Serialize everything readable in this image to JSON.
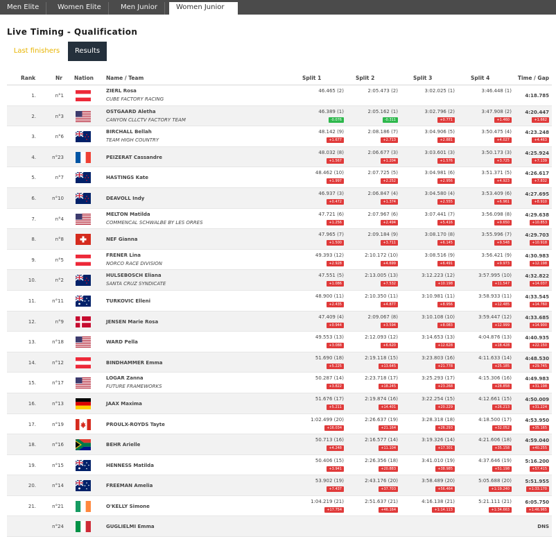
{
  "tabs": [
    "Men Elite",
    "Women Elite",
    "Men Junior",
    "Women Junior"
  ],
  "title": "Live Timing - Qualification",
  "subtabs": {
    "last_finishers": "Last finishers",
    "results": "Results"
  },
  "columns": {
    "rank": "Rank",
    "nr": "Nr",
    "nation": "Nation",
    "name": "Name / Team",
    "split1": "Split 1",
    "split2": "Split 2",
    "split3": "Split 3",
    "split4": "Split 4",
    "time": "Time / Gap"
  },
  "colors": {
    "gap_red": "#e03a3a",
    "gap_green": "#2db84c",
    "accent_yellow": "#e8b400",
    "tab_bar": "#4b4b4b",
    "active_button": "#24303c"
  },
  "rows": [
    {
      "rank": "1.",
      "nr": "n°1",
      "flag": "at",
      "name": "ZIERL Rosa",
      "team": "CUBE FACTORY RACING",
      "s1": "46.465 (2)",
      "s1g": "",
      "s2": "2:05.473 (2)",
      "s2g": "",
      "s3": "3:02.025 (1)",
      "s3g": "",
      "s4": "3:46.448 (1)",
      "s4g": "",
      "time": "4:18.785",
      "gap": ""
    },
    {
      "rank": "2.",
      "nr": "n°3",
      "flag": "us",
      "name": "OSTGAARD Aletha",
      "team": "CANYON CLLCTV FACTORY TEAM",
      "s1": "46.389 (1)",
      "s1g": "-0.076",
      "s1c": "g",
      "s2": "2:05.162 (1)",
      "s2g": "-0.311",
      "s2c": "g",
      "s3": "3:02.796 (2)",
      "s3g": "+0.771",
      "s4": "3:47.908 (2)",
      "s4g": "+1.460",
      "time": "4:20.447",
      "gap": "+1.662"
    },
    {
      "rank": "3.",
      "nr": "n°6",
      "flag": "nz",
      "name": "BIRCHALL Bellah",
      "team": "TEAM HIGH COUNTRY",
      "s1": "48.142 (9)",
      "s1g": "+1.677",
      "s2": "2:08.186 (7)",
      "s2g": "+2.713",
      "s3": "3:04.906 (5)",
      "s3g": "+2.881",
      "s4": "3:50.475 (4)",
      "s4g": "+4.027",
      "time": "4:23.248",
      "gap": "+4.463"
    },
    {
      "rank": "4.",
      "nr": "n°23",
      "flag": "fr",
      "name": "PEIZERAT Cassandre",
      "team": "",
      "s1": "48.032 (8)",
      "s1g": "+1.567",
      "s2": "2:06.677 (3)",
      "s2g": "+1.204",
      "s3": "3:03.601 (3)",
      "s3g": "+1.576",
      "s4": "3:50.173 (3)",
      "s4g": "+3.725",
      "time": "4:25.924",
      "gap": "+7.139"
    },
    {
      "rank": "5.",
      "nr": "n°7",
      "flag": "nz",
      "name": "HASTINGS Kate",
      "team": "",
      "s1": "48.462 (10)",
      "s1g": "+1.997",
      "s2": "2:07.725 (5)",
      "s2g": "+2.252",
      "s3": "3:04.981 (6)",
      "s3g": "+2.956",
      "s4": "3:51.371 (5)",
      "s4g": "+4.923",
      "time": "4:26.617",
      "gap": "+7.832"
    },
    {
      "rank": "6.",
      "nr": "n°10",
      "flag": "nz",
      "name": "DEAVOLL Indy",
      "team": "",
      "s1": "46.937 (3)",
      "s1g": "+0.472",
      "s2": "2:06.847 (4)",
      "s2g": "+1.374",
      "s3": "3:04.580 (4)",
      "s3g": "+2.555",
      "s4": "3:53.409 (6)",
      "s4g": "+6.961",
      "time": "4:27.695",
      "gap": "+8.910"
    },
    {
      "rank": "7.",
      "nr": "n°4",
      "flag": "us",
      "name": "MELTON Matilda",
      "team": "COMMENCAL SCHWALBE BY LES ORRES",
      "s1": "47.721 (6)",
      "s1g": "+1.256",
      "s2": "2:07.967 (6)",
      "s2g": "+2.494",
      "s3": "3:07.441 (7)",
      "s3g": "+5.416",
      "s4": "3:56.098 (8)",
      "s4g": "+9.650",
      "time": "4:29.638",
      "gap": "+10.853"
    },
    {
      "rank": "8.",
      "nr": "n°8",
      "flag": "ch",
      "name": "NEF Gianna",
      "team": "",
      "s1": "47.965 (7)",
      "s1g": "+1.500",
      "s2": "2:09.184 (9)",
      "s2g": "+3.711",
      "s3": "3:08.170 (8)",
      "s3g": "+6.145",
      "s4": "3:55.996 (7)",
      "s4g": "+9.548",
      "time": "4:29.703",
      "gap": "+10.918"
    },
    {
      "rank": "9.",
      "nr": "n°5",
      "flag": "at",
      "name": "FRENER Lina",
      "team": "NORCO RACE DIVISION",
      "s1": "49.393 (12)",
      "s1g": "+2.928",
      "s2": "2:10.172 (10)",
      "s2g": "+4.699",
      "s3": "3:08.516 (9)",
      "s3g": "+6.491",
      "s4": "3:56.421 (9)",
      "s4g": "+9.973",
      "time": "4:30.983",
      "gap": "+12.198"
    },
    {
      "rank": "10.",
      "nr": "n°2",
      "flag": "nz",
      "name": "HULSEBOSCH Eliana",
      "team": "SANTA CRUZ SYNDICATE",
      "s1": "47.551 (5)",
      "s1g": "+1.086",
      "s2": "2:13.005 (13)",
      "s2g": "+7.532",
      "s3": "3:12.223 (12)",
      "s3g": "+10.198",
      "s4": "3:57.995 (10)",
      "s4g": "+11.547",
      "time": "4:32.822",
      "gap": "+14.037"
    },
    {
      "rank": "11.",
      "nr": "n°11",
      "flag": "au",
      "name": "TURKOVIC Elleni",
      "team": "",
      "s1": "48.900 (11)",
      "s1g": "+2.435",
      "s2": "2:10.350 (11)",
      "s2g": "+4.877",
      "s3": "3:10.981 (11)",
      "s3g": "+8.956",
      "s4": "3:58.933 (11)",
      "s4g": "+12.485",
      "time": "4:33.545",
      "gap": "+14.760"
    },
    {
      "rank": "12.",
      "nr": "n°9",
      "flag": "dk",
      "name": "JENSEN Marie Rosa",
      "team": "",
      "s1": "47.409 (4)",
      "s1g": "+0.944",
      "s2": "2:09.067 (8)",
      "s2g": "+3.594",
      "s3": "3:10.108 (10)",
      "s3g": "+8.083",
      "s4": "3:59.447 (12)",
      "s4g": "+12.999",
      "time": "4:33.685",
      "gap": "+14.900"
    },
    {
      "rank": "13.",
      "nr": "n°18",
      "flag": "us",
      "name": "WARD Pella",
      "team": "",
      "s1": "49.553 (13)",
      "s1g": "+3.088",
      "s2": "2:12.093 (12)",
      "s2g": "+6.620",
      "s3": "3:14.653 (13)",
      "s3g": "+12.628",
      "s4": "4:04.876 (13)",
      "s4g": "+18.428",
      "time": "4:40.935",
      "gap": "+22.150"
    },
    {
      "rank": "14.",
      "nr": "n°12",
      "flag": "at",
      "name": "BINDHAMMER Emma",
      "team": "",
      "s1": "51.690 (18)",
      "s1g": "+5.225",
      "s2": "2:19.118 (15)",
      "s2g": "+13.645",
      "s3": "3:23.803 (16)",
      "s3g": "+21.778",
      "s4": "4:11.633 (14)",
      "s4g": "+25.185",
      "time": "4:48.530",
      "gap": "+29.745"
    },
    {
      "rank": "15.",
      "nr": "n°17",
      "flag": "us",
      "name": "LOGAR Zanna",
      "team": "FUTURE FRAMEWORKS",
      "s1": "50.287 (14)",
      "s1g": "+3.822",
      "s2": "2:23.718 (17)",
      "s2g": "+18.245",
      "s3": "3:25.293 (17)",
      "s3g": "+23.268",
      "s4": "4:15.306 (16)",
      "s4g": "+28.858",
      "time": "4:49.983",
      "gap": "+31.198"
    },
    {
      "rank": "16.",
      "nr": "n°13",
      "flag": "de",
      "name": "JAAX Maxima",
      "team": "",
      "s1": "51.676 (17)",
      "s1g": "+5.211",
      "s2": "2:19.874 (16)",
      "s2g": "+14.401",
      "s3": "3:22.254 (15)",
      "s3g": "+20.229",
      "s4": "4:12.661 (15)",
      "s4g": "+26.213",
      "time": "4:50.009",
      "gap": "+31.224"
    },
    {
      "rank": "17.",
      "nr": "n°19",
      "flag": "ca",
      "name": "PROULX-ROYDS Tayte",
      "team": "",
      "s1": "1:02.499 (20)",
      "s1g": "+16.034",
      "s2": "2:26.637 (19)",
      "s2g": "+21.164",
      "s3": "3:28.318 (18)",
      "s3g": "+26.293",
      "s4": "4:18.500 (17)",
      "s4g": "+32.052",
      "time": "4:53.950",
      "gap": "+35.165"
    },
    {
      "rank": "18.",
      "nr": "n°16",
      "flag": "za",
      "name": "BEHR Arielle",
      "team": "",
      "s1": "50.713 (16)",
      "s1g": "+4.248",
      "s2": "2:16.577 (14)",
      "s2g": "+11.104",
      "s3": "3:19.326 (14)",
      "s3g": "+17.301",
      "s4": "4:21.606 (18)",
      "s4g": "+35.158",
      "time": "4:59.040",
      "gap": "+40.255"
    },
    {
      "rank": "19.",
      "nr": "n°15",
      "flag": "au",
      "name": "HENNESS Matilda",
      "team": "",
      "s1": "50.406 (15)",
      "s1g": "+3.941",
      "s2": "2:26.356 (18)",
      "s2g": "+20.883",
      "s3": "3:41.010 (19)",
      "s3g": "+38.985",
      "s4": "4:37.646 (19)",
      "s4g": "+51.198",
      "time": "5:16.200",
      "gap": "+57.415"
    },
    {
      "rank": "20.",
      "nr": "n°14",
      "flag": "au",
      "name": "FREEMAN Amelia",
      "team": "",
      "s1": "53.902 (19)",
      "s1g": "+7.437",
      "s2": "2:43.176 (20)",
      "s2g": "+37.703",
      "s3": "3:58.489 (20)",
      "s3g": "+56.464",
      "s4": "5:05.688 (20)",
      "s4g": "+1:19.240",
      "time": "5:51.955",
      "gap": "+1:33.170"
    },
    {
      "rank": "21.",
      "nr": "n°21",
      "flag": "ie",
      "name": "O'KELLY Simone",
      "team": "",
      "s1": "1:04.219 (21)",
      "s1g": "+17.754",
      "s2": "2:51.637 (21)",
      "s2g": "+46.164",
      "s3": "4:16.138 (21)",
      "s3g": "+1:14.113",
      "s4": "5:21.111 (21)",
      "s4g": "+1:34.663",
      "time": "6:05.750",
      "gap": "+1:46.965"
    },
    {
      "rank": "",
      "nr": "n°24",
      "flag": "it",
      "name": "GUGLIELMI Emma",
      "team": "",
      "s1": "",
      "s1g": "",
      "s2": "",
      "s2g": "",
      "s3": "",
      "s3g": "",
      "s4": "",
      "s4g": "",
      "time": "DNS",
      "gap": ""
    }
  ]
}
